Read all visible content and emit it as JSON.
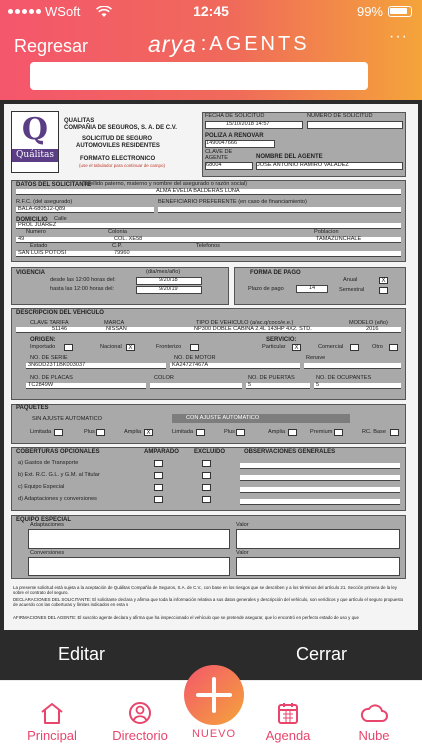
{
  "status": {
    "carrier": "WSoft",
    "time": "12:45",
    "battery": "99%"
  },
  "nav": {
    "back": "Regresar",
    "brand": "arya",
    "product": ":AGENTS",
    "more": "···"
  },
  "form": {
    "company_line": "QUALITAS",
    "company": "COMPAÑIA DE SEGUROS, S. A. DE C.V.",
    "title1": "SOLICITUD DE SEGURO",
    "title2": "AUTOMOVILES RESIDENTES",
    "format": "FORMATO ELECTRONICO",
    "format_note": "(use el tabulador para continuar de campo)",
    "logo_text": "Quálitas",
    "fecha_label": "FECHA DE SOLICITUD",
    "fecha": "15/10/2018 14:57",
    "num_sol_label": "NUMERO DE SOLICITUD",
    "poliza_label": "POLIZA A RENOVAR",
    "poliza": "1490047666",
    "clave_label": "CLAVE DE AGENTE",
    "clave": "68004",
    "agente_label": "NOMBRE DEL AGENTE",
    "agente": "JOSE ANTONIO RAMIRO VALADEZ",
    "solicitante_label": "DATOS DEL SOLICITANTE",
    "solicitante_note": "(apellido paterno, materno y nombre del asegurado o razón social)",
    "solicitante": "ALMA EVELIA BALDERAS LUNA",
    "rfc_label": "R.F.C. (del asegurado)",
    "rfc": "BALA-680512-Q89",
    "beneficiario_label": "BENEFICIARIO PREFERENTE (en caso de financiamiento)",
    "domicilio_label": "DOMICILIO",
    "calle_label": "Calle",
    "calle": "PROL JUAREZ",
    "numero_label": "Numero",
    "numero": "49",
    "colonia_label": "Colonia",
    "colonia": "COL. XE58",
    "poblacion_label": "Poblacion",
    "poblacion": "TAMAZUNCHALE",
    "estado_label": "Estado",
    "estado": "SAN LUIS POTOSI",
    "cp_label": "C.P.",
    "cp": "79960",
    "telefonos_label": "Telefonos",
    "vigencia_label": "VIGENCIA",
    "vig_unit": "(dia/mes/año)",
    "desde_label": "desde las 12:00 horas del:",
    "desde": "9/20/18",
    "hasta_label": "hasta las 12:00 horas del:",
    "hasta": "9/20/19",
    "pago_label": "FORMA DE PAGO",
    "plazo_label": "Plazo de pago",
    "plazo": "14",
    "anual_label": "Anual",
    "semestral_label": "Semestral",
    "anual_mark": "X",
    "vehiculo_label": "DESCRIPCION DEL VEHICULO",
    "tarifa_label": "CLAVE TARIFA",
    "tarifa": "51146",
    "marca_label": "MARCA",
    "marca": "NISSAN",
    "tipo_label": "TIPO DE VEHICULO (a/ac.q/coco/e.e.)",
    "tipo": "NP300 DOBLE CABINA 2.4L 143HP 4X2. STD.",
    "modelo_label": "MODELO (año)",
    "modelo": "2016",
    "origen_label": "ORIGEN:",
    "importado_label": "Importado",
    "nacional_label": "Nacional",
    "nacional_mark": "X",
    "fronterizo_label": "Fronterizo",
    "servicio_label": "SERVICIO:",
    "particular_label": "Particular",
    "particular_mark": "X",
    "comercial_label": "Comercial",
    "otro_label": "Otro",
    "serie_label": "NO. DE SERIE",
    "serie": "3N6DD23T1BK003037",
    "motor_label": "NO. DE MOTOR",
    "motor": "KA24727467A",
    "renave_label": "Renave",
    "placas_label": "NO. DE PLACAS",
    "placas": "TC2849W",
    "color_label": "COLOR",
    "puertas_label": "NO. DE PUERTAS",
    "puertas": "5",
    "ocupantes_label": "NO. DE OCUPANTES",
    "ocupantes": "5",
    "paquetes_label": "PAQUETES",
    "sin_ajuste": "SIN AJUSTE AUTOMATICO",
    "con_ajuste": "CON AJUSTE AUTOMATICO",
    "limitada_label": "Limitada",
    "plus_label": "Plus",
    "amplia_label": "Amplia",
    "amplia_mark": "X",
    "premium_label": "Premium",
    "rcbase_label": "RC. Base",
    "coberturas_label": "COBERTURAS OPCIONALES",
    "amparado_label": "AMPARADO",
    "excluido_label": "EXCLUIDO",
    "obs_label": "OBSERVACIONES GENERALES",
    "cob_a": "a) Gastos de Transporte",
    "cob_b": "b) Ext. R.C. G.L. y G.M. al Titular",
    "cob_c": "c) Equipo Especial",
    "cob_d": "d) Adaptaciones y conversiones",
    "equipo_label": "EQUIPO ESPECIAL",
    "adaptaciones_label": "Adaptaciones",
    "conversiones_label": "Conversiones",
    "valor_label": "Valor",
    "legal1": "La presente solicitud está sujeta a la aceptación de Quálitas Compañía de Seguros, S.A. de C.V., con base en los riesgos que se describen y a los términos del artículo 21. Sección primera de la ley sobre el contrato del seguro.",
    "legal2": "DECLARACIONES DEL SOLICITANTE: El solicitante declara y afirma que toda la información relativa a sus datos generales y descripción del vehículo, son verídicos y que artículo el seguro propuesto de acuerdo con las coberturas y límites indicados en esta s",
    "legal3": "AFIRMACIONES DEL AGENTE: El suscrito agente declara y afirma que ha inspeccionado el vehículo que se pretende asegurar, que lo encontró en perfecto estado de uso y que"
  },
  "actions": {
    "edit": "Editar",
    "close": "Cerrar"
  },
  "tabs": {
    "principal": "Principal",
    "directorio": "Directorio",
    "nuevo": "NUEVO",
    "agenda": "Agenda",
    "nube": "Nube"
  },
  "colors": {
    "accent": "#e8466c",
    "gradient_start": "#f4566c",
    "gradient_end": "#f4a43a",
    "dark": "#2b2b2b"
  }
}
